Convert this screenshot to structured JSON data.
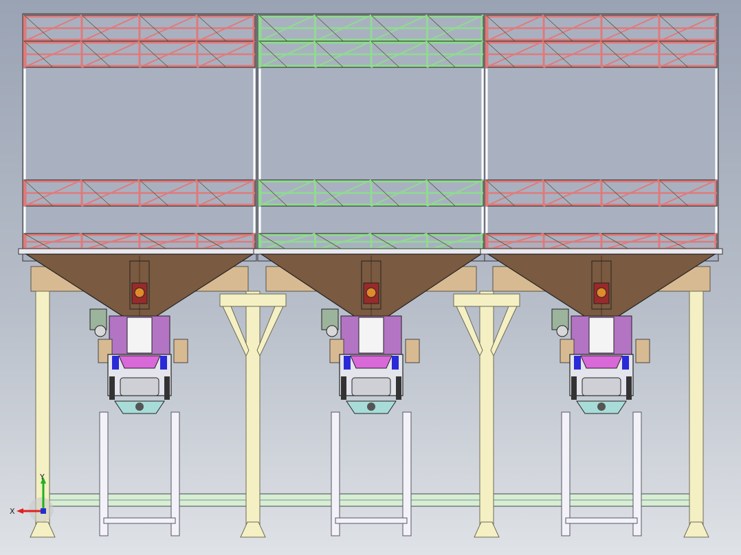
{
  "viewport": {
    "name": "cad-graphics-area",
    "background_top": "#9aa3b4",
    "background_bottom": "#dfe2e6"
  },
  "colors": {
    "truss_red": "#e07a7a",
    "truss_green": "#8fdc8f",
    "hopper": "#7a5a40",
    "beam_tan": "#d8ba92",
    "column": "#f5f0c4",
    "column_stroke": "#6b6a55",
    "base_beam": "#d6efd3",
    "silo_body": "#a9b1c1",
    "motor": "#9cb49c",
    "chute_purple": "#b374c4",
    "magenta": "#d968d9",
    "blue_accent": "#2a2ad8",
    "bagger_cyan": "#a8dcd8",
    "orange_valve": "#e08a2a",
    "dark_red_valve": "#9a2a2a",
    "leg_white": "#f2f2f8"
  },
  "modules": [
    {
      "name": "silo-module-left",
      "truss_color": "truss_red"
    },
    {
      "name": "silo-module-center",
      "truss_color": "truss_green"
    },
    {
      "name": "silo-module-right",
      "truss_color": "truss_red"
    }
  ],
  "triad": {
    "x_label": "X",
    "y_label": "Y",
    "x_color": "#e02020",
    "y_color": "#20b020",
    "z_color": "#2030d0"
  }
}
